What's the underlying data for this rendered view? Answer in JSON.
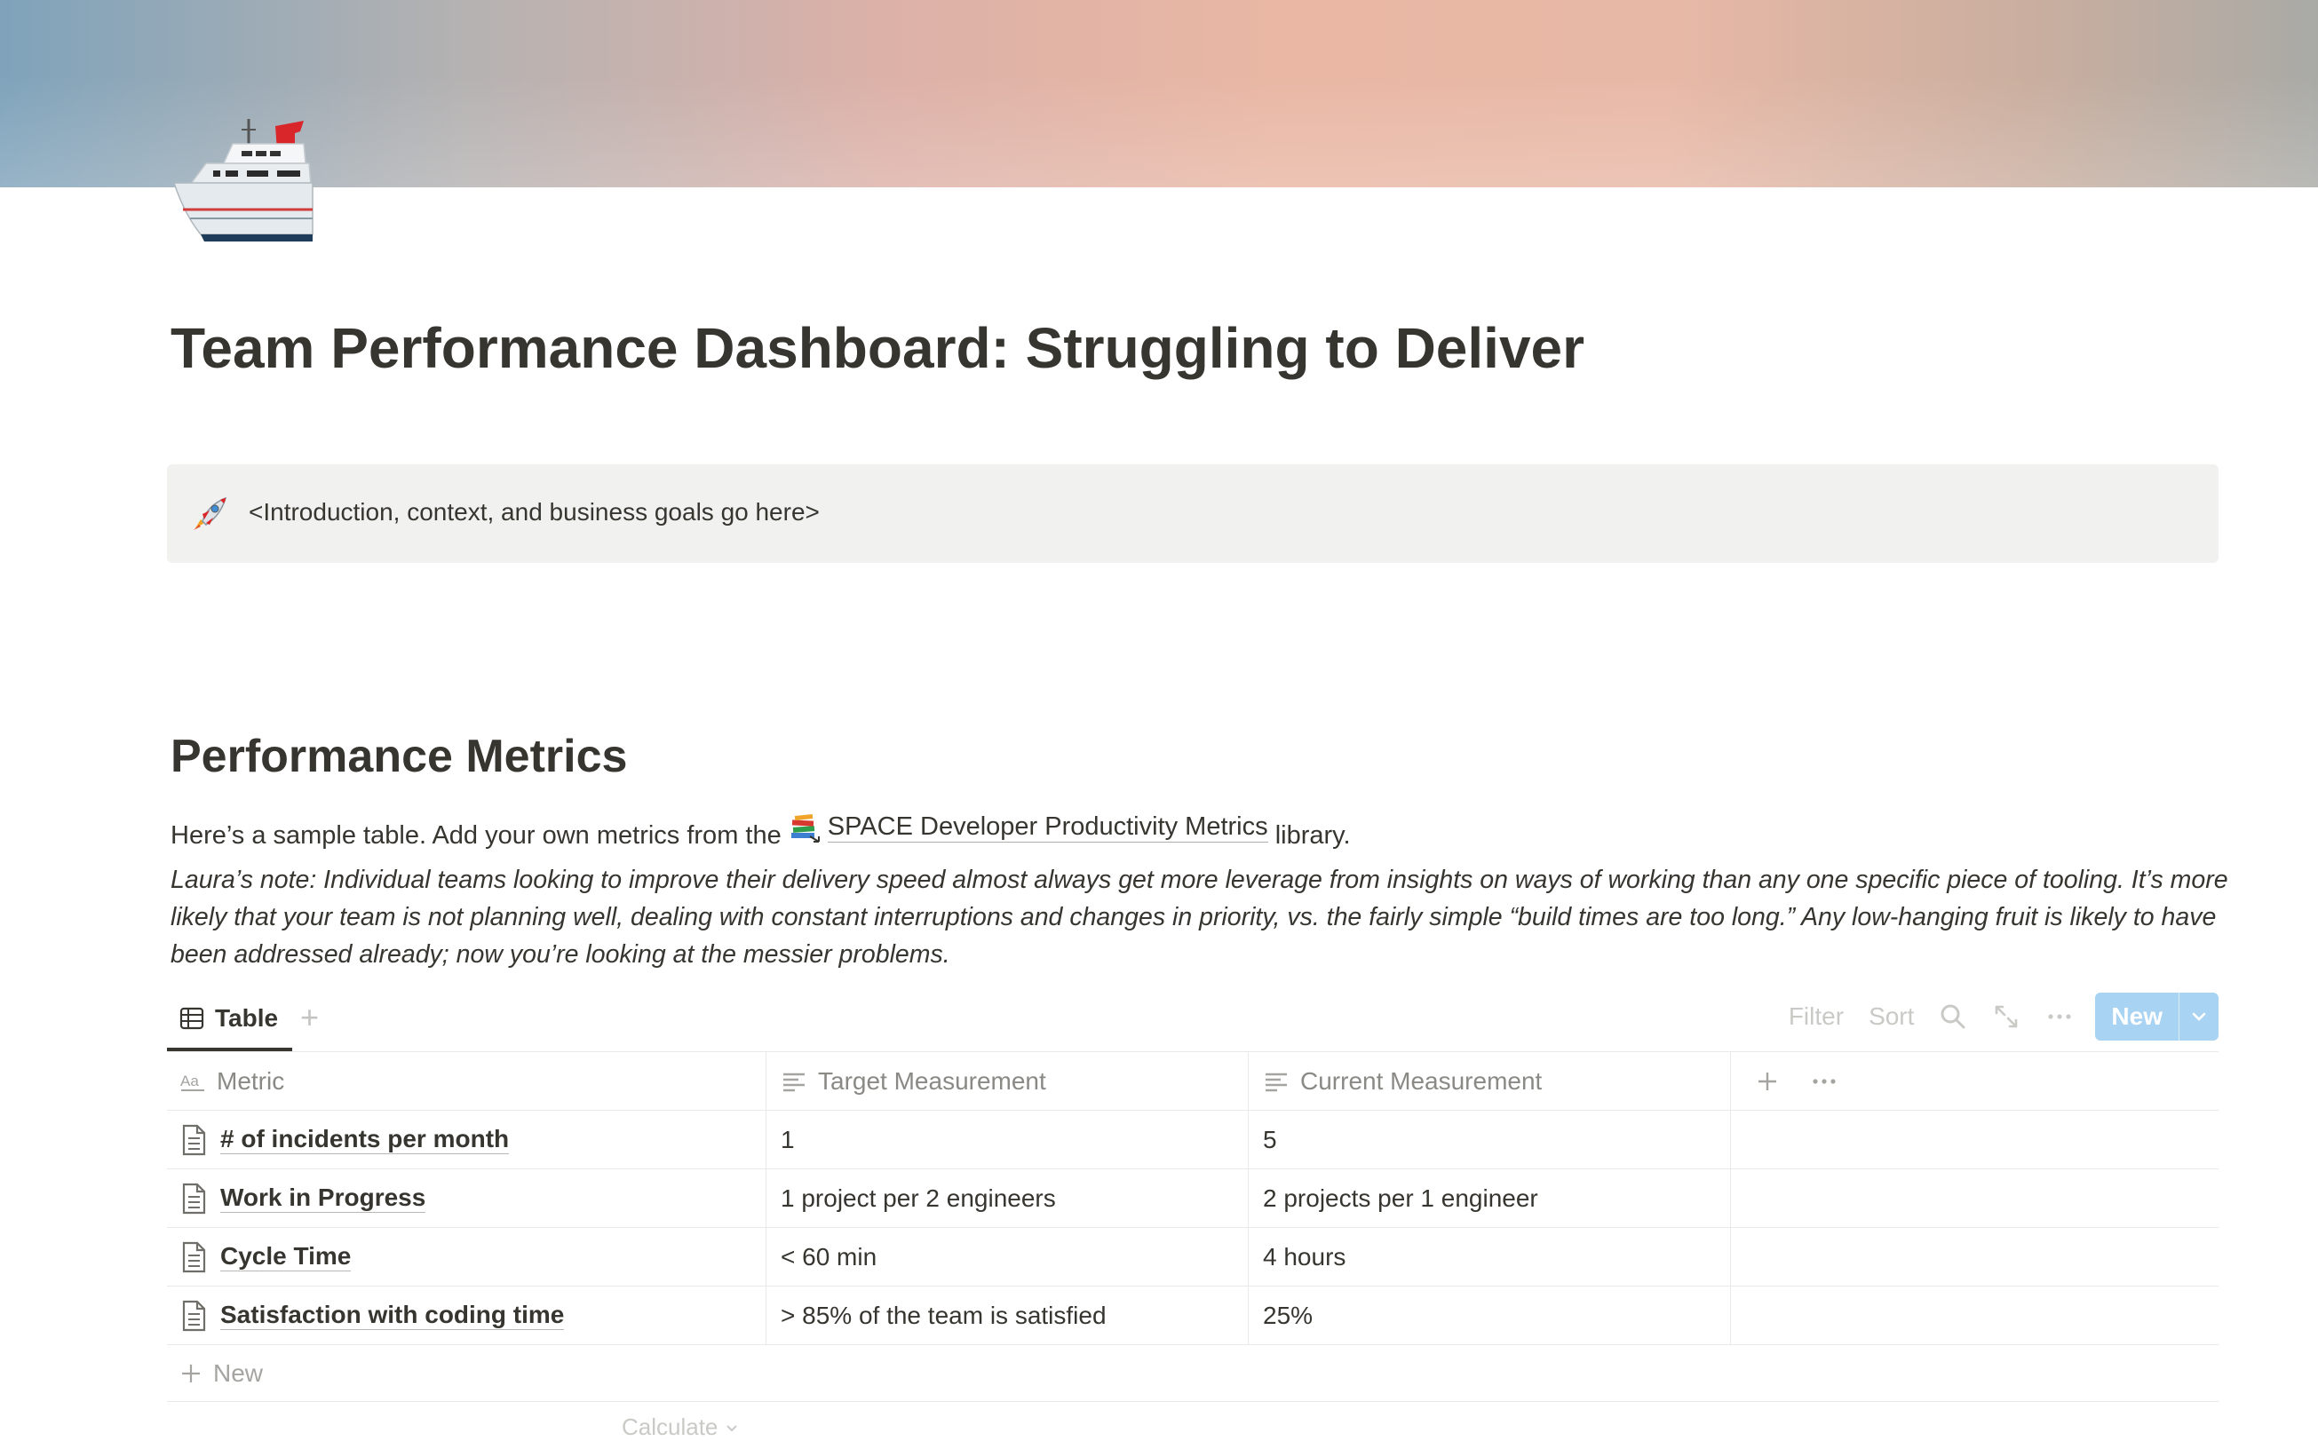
{
  "cover": {
    "icon": "cruise-ship-icon"
  },
  "title": "Team Performance Dashboard: Struggling to Deliver",
  "callout": {
    "icon": "rocket-icon",
    "text": "<Introduction, context, and business goals go here>"
  },
  "section": {
    "heading": "Performance Metrics",
    "intro_before": "Here’s a sample table. Add your own metrics from the",
    "intro_link": "SPACE Developer Productivity Metrics",
    "intro_link_icon": "books-icon",
    "intro_after": "library.",
    "note": "Laura’s note: Individual teams looking to improve their delivery speed almost always get more leverage from insights on ways of working than any one specific piece of tooling. It’s more likely that your team is not planning well, dealing with constant interruptions and changes in priority, vs. the fairly simple “build times are too long.” Any low-hanging fruit is likely to have been addressed already; now you’re looking at the messier problems."
  },
  "database": {
    "view_tab": "Table",
    "toolbar": {
      "filter": "Filter",
      "sort": "Sort",
      "new": "New"
    },
    "columns": [
      "Metric",
      "Target Measurement",
      "Current Measurement"
    ],
    "rows": [
      {
        "metric": "# of incidents per month",
        "target": "1",
        "current": "5"
      },
      {
        "metric": "Work in Progress",
        "target": "1 project per 2 engineers",
        "current": "2 projects per 1 engineer"
      },
      {
        "metric": "Cycle Time",
        "target": "< 60 min",
        "current": "4 hours"
      },
      {
        "metric": "Satisfaction with coding time",
        "target": "> 85% of the team is satisfied",
        "current": "25%"
      }
    ],
    "new_row": "New",
    "calculate": "Calculate"
  }
}
